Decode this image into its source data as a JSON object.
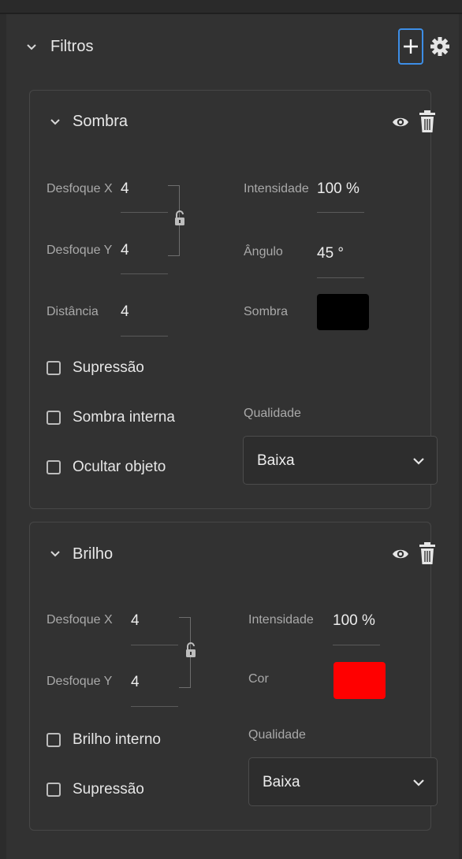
{
  "header": {
    "title": "Filtros",
    "add_icon": "plus-icon",
    "settings_icon": "gear-icon"
  },
  "filters": [
    {
      "name": "Sombra",
      "blur_x": {
        "label": "Desfoque X",
        "value": "4"
      },
      "blur_y": {
        "label": "Desfoque Y",
        "value": "4"
      },
      "distance": {
        "label": "Distância",
        "value": "4"
      },
      "intensity": {
        "label": "Intensidade",
        "value": "100",
        "unit": "%"
      },
      "angle": {
        "label": "Ângulo",
        "value": "45",
        "unit": "°"
      },
      "color": {
        "label": "Sombra",
        "hex": "#000000"
      },
      "checkboxes": [
        "Supressão",
        "Sombra interna",
        "Ocultar objeto"
      ],
      "quality": {
        "label": "Qualidade",
        "value": "Baixa"
      }
    },
    {
      "name": "Brilho",
      "blur_x": {
        "label": "Desfoque X",
        "value": "4"
      },
      "blur_y": {
        "label": "Desfoque Y",
        "value": "4"
      },
      "intensity": {
        "label": "Intensidade",
        "value": "100",
        "unit": "%"
      },
      "color": {
        "label": "Cor",
        "hex": "#ff0000"
      },
      "checkboxes": [
        "Brilho interno",
        "Supressão"
      ],
      "quality": {
        "label": "Qualidade",
        "value": "Baixa"
      }
    }
  ],
  "colors": {
    "accent": "#3d8ee6",
    "background": "#323232"
  }
}
